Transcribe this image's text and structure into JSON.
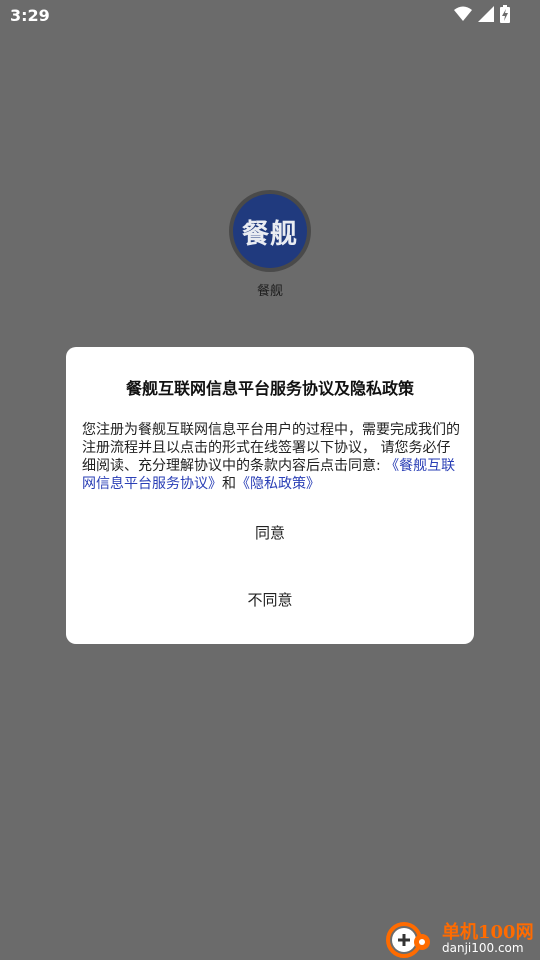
{
  "status_bar": {
    "time": "3:29",
    "icons": [
      "wifi-icon",
      "signal-icon",
      "battery-charging-icon"
    ]
  },
  "app": {
    "logo_text": "餐舰",
    "name": "餐舰"
  },
  "dialog": {
    "title": "餐舰互联网信息平台服务协议及隐私政策",
    "body_prefix": "您注册为餐舰互联网信息平台用户的过程中，需要完成我们的注册流程并且以点击的形式在线签署以下协议， 请您务必仔细阅读、充分理解协议中的条款内容后点击同意: ",
    "link_service": "《餐舰互联网信息平台服务协议》",
    "and_text": "和",
    "link_privacy": "《隐私政策》",
    "agree_label": "同意",
    "disagree_label": "不同意"
  },
  "watermark": {
    "title": "单机100网",
    "url": "danji100.com"
  },
  "colors": {
    "overlay": "#6b6b6b",
    "link": "#2a3fb6",
    "logo_bg": "#203a7e",
    "watermark_orange": "#ff6b00"
  }
}
